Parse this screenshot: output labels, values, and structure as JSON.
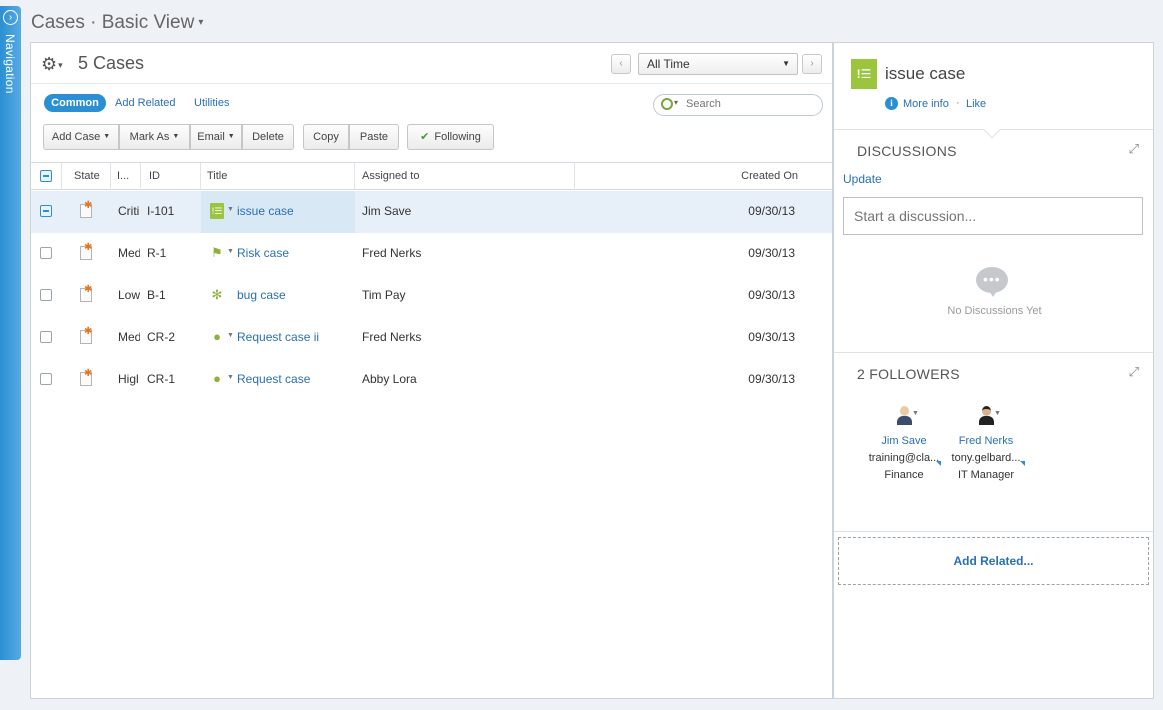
{
  "navigation": {
    "label": "Navigation"
  },
  "page": {
    "title": "Cases · Basic View"
  },
  "toolbar": {
    "case_count": "5 Cases",
    "time_filter": "All Time",
    "search_placeholder": "Search"
  },
  "tabs": [
    {
      "label": "Common",
      "active": true
    },
    {
      "label": "Add Related"
    },
    {
      "label": "Utilities"
    }
  ],
  "buttons": {
    "add_case": "Add Case",
    "mark_as": "Mark As",
    "email": "Email",
    "delete": "Delete",
    "copy": "Copy",
    "paste": "Paste",
    "following": "Following"
  },
  "grid": {
    "columns": [
      "State",
      "I...",
      "ID",
      "Title",
      "Assigned to",
      "Created On"
    ],
    "rows": [
      {
        "importance": "Criti",
        "id": "I-101",
        "title": "issue case",
        "icon": "issue-list-icon",
        "assigned": "Jim Save",
        "created": "09/30/13",
        "selected": true
      },
      {
        "importance": "Med",
        "id": "R-1",
        "title": "Risk case",
        "icon": "flag-icon",
        "assigned": "Fred Nerks",
        "created": "09/30/13"
      },
      {
        "importance": "Low",
        "id": "B-1",
        "title": "bug case",
        "icon": "bug-icon",
        "assigned": "Tim Pay",
        "created": "09/30/13"
      },
      {
        "importance": "Med",
        "id": "CR-2",
        "title": "Request case ii",
        "icon": "lightbulb-icon",
        "assigned": "Fred Nerks",
        "created": "09/30/13"
      },
      {
        "importance": "Higl",
        "id": "CR-1",
        "title": "Request case",
        "icon": "lightbulb-icon",
        "assigned": "Abby Lora",
        "created": "09/30/13"
      }
    ]
  },
  "detail": {
    "title": "issue case",
    "more_info": "More info",
    "like": "Like",
    "separator": "·",
    "discussions_title": "DISCUSSIONS",
    "update_label": "Update",
    "discussion_placeholder": "Start a discussion...",
    "no_discussions": "No Discussions Yet",
    "followers_title": "2 FOLLOWERS",
    "followers": [
      {
        "name": "Jim Save",
        "email": "training@cla...",
        "role": "Finance"
      },
      {
        "name": "Fred Nerks",
        "email": "tony.gelbard...",
        "role": "IT Manager"
      }
    ],
    "add_related": "Add Related..."
  },
  "colors": {
    "accent": "#2b8fd3",
    "link": "#2a6fb3",
    "case_icon": "#9bc53d",
    "state_star": "#e8751a"
  }
}
